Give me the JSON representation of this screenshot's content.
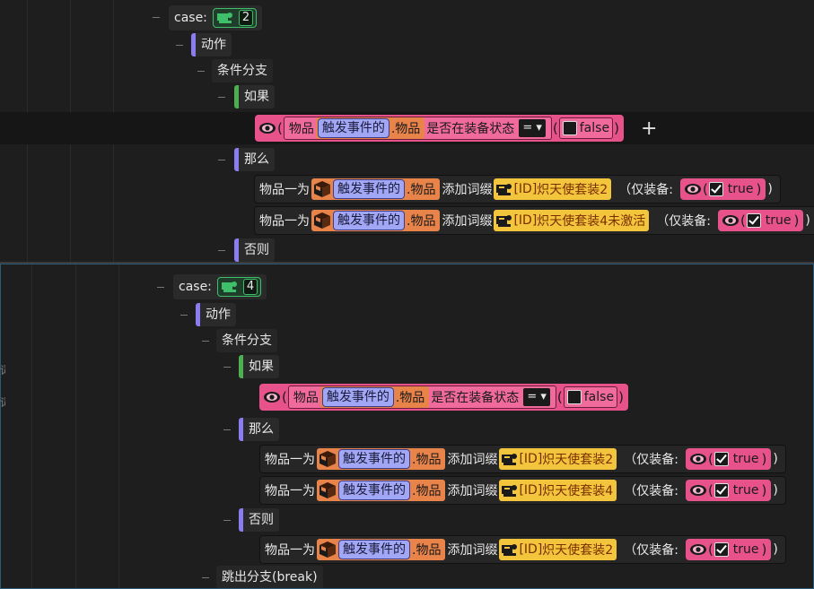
{
  "top": {
    "case_label": "case:",
    "case_value": "2",
    "action_label": "动作",
    "branch_label": "条件分支",
    "if_label": "如果",
    "then_label": "那么",
    "else_label": "否则",
    "condition": {
      "item_word": "物品",
      "trigger": "触发事件的",
      "prop": ".物品",
      "state": "是否在装备状态",
      "op": "=",
      "bool": "false"
    },
    "actions": [
      {
        "prefix": "物品一为",
        "trigger": "触发事件的",
        "prop": ".物品",
        "verb": "添加词缀",
        "affix_id": "[ID]",
        "affix_name": "炽天使套装2",
        "equip_label": "（仅装备:",
        "bool": "true",
        "close": ")"
      },
      {
        "prefix": "物品一为",
        "trigger": "触发事件的",
        "prop": ".物品",
        "verb": "添加词缀",
        "affix_id": "[ID]",
        "affix_name": "炽天使套装4未激活",
        "equip_label": "（仅装备:",
        "bool": "true",
        "close": ")"
      }
    ]
  },
  "bottom": {
    "case_label": "case:",
    "case_value": "4",
    "action_label": "动作",
    "branch_label": "条件分支",
    "if_label": "如果",
    "then_label": "那么",
    "else_label": "否则",
    "break_label": "跳出分支(break)",
    "condition": {
      "item_word": "物品",
      "trigger": "触发事件的",
      "prop": ".物品",
      "state": "是否在装备状态",
      "op": "=",
      "bool": "false"
    },
    "then_actions": [
      {
        "prefix": "物品一为",
        "trigger": "触发事件的",
        "prop": ".物品",
        "verb": "添加词缀",
        "affix_id": "[ID]",
        "affix_name": "炽天使套装2",
        "equip_label": "（仅装备:",
        "bool": "true",
        "close": ")"
      },
      {
        "prefix": "物品一为",
        "trigger": "触发事件的",
        "prop": ".物品",
        "verb": "添加词缀",
        "affix_id": "[ID]",
        "affix_name": "炽天使套装4",
        "equip_label": "（仅装备:",
        "bool": "true",
        "close": ")"
      }
    ],
    "else_actions": [
      {
        "prefix": "物品一为",
        "trigger": "触发事件的",
        "prop": ".物品",
        "verb": "添加词缀",
        "affix_id": "[ID]",
        "affix_name": "炽天使套装2",
        "equip_label": "（仅装备:",
        "bool": "true",
        "close": ")"
      }
    ]
  },
  "left_edge_glyph": "词",
  "add_symbol": "+",
  "colors": {
    "accent_pink": "#e8528a",
    "accent_orange": "#e8834a",
    "accent_yellow": "#f2c53d",
    "accent_blue": "#a2a7f5",
    "tree_purple": "#8b7cf0",
    "tree_green": "#4caf50"
  }
}
